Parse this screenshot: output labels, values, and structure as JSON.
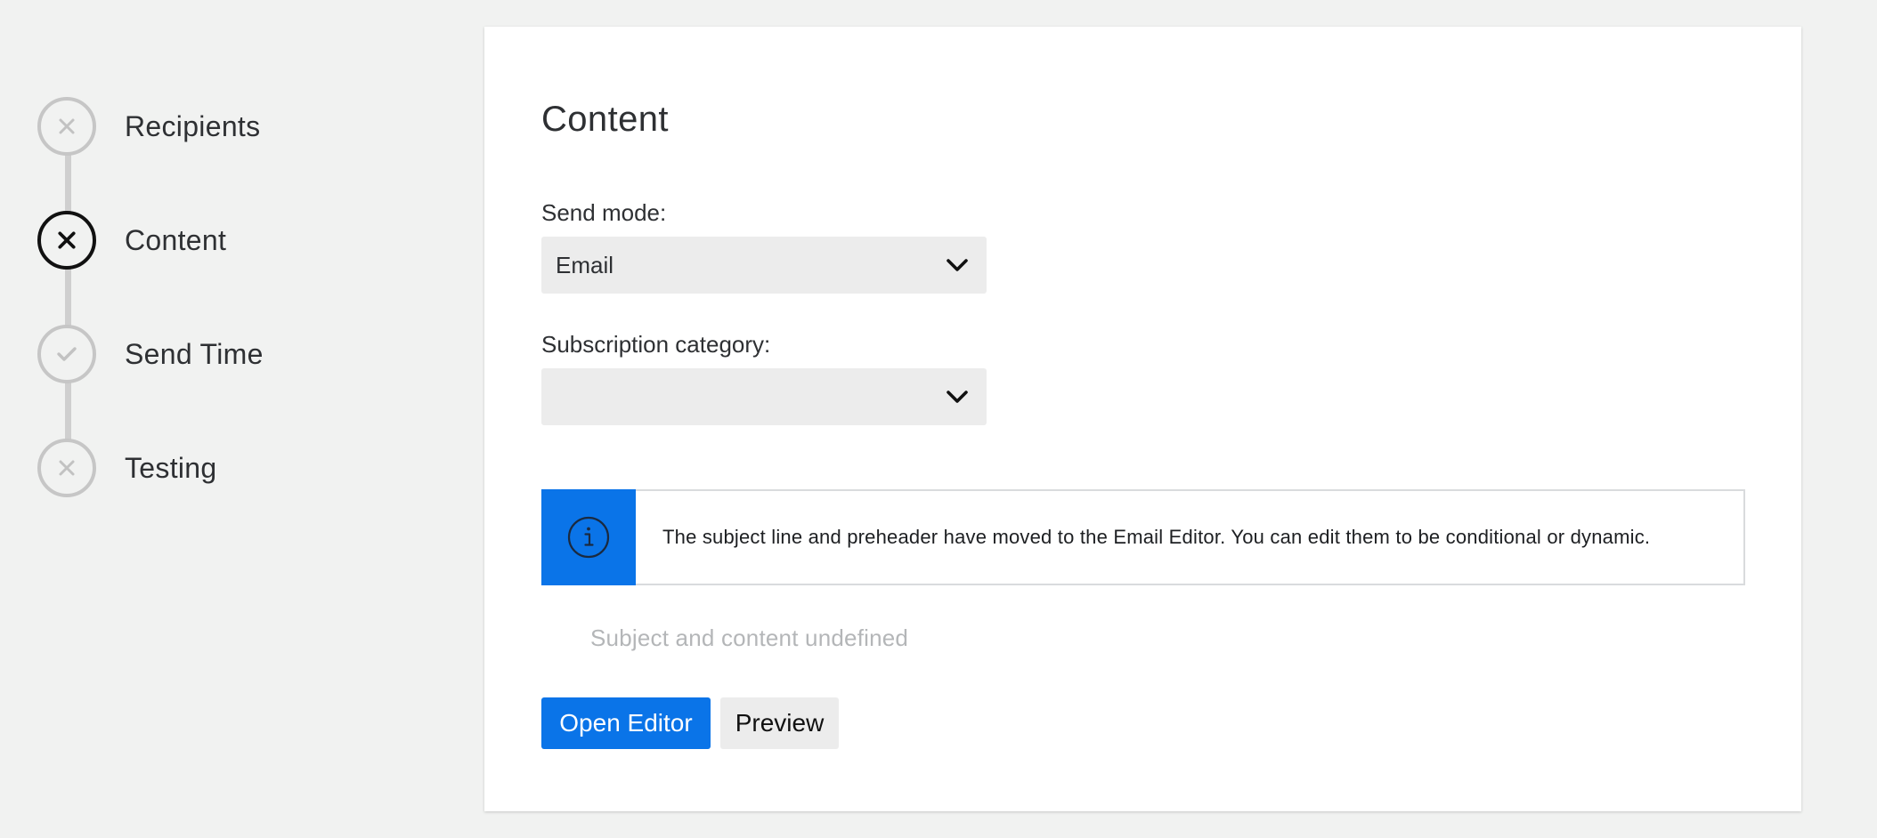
{
  "stepper": {
    "steps": [
      {
        "label": "Recipients",
        "status": "incomplete",
        "icon": "x-icon"
      },
      {
        "label": "Content",
        "status": "active",
        "icon": "x-icon"
      },
      {
        "label": "Send Time",
        "status": "complete",
        "icon": "check-icon"
      },
      {
        "label": "Testing",
        "status": "incomplete",
        "icon": "x-icon"
      }
    ]
  },
  "content": {
    "title": "Content",
    "send_mode": {
      "label": "Send mode:",
      "value": "Email"
    },
    "subscription_category": {
      "label": "Subscription category:",
      "value": ""
    },
    "notice": {
      "icon": "info-icon",
      "text": "The subject line and preheader have moved to the Email Editor. You can edit them to be conditional or dynamic."
    },
    "status_text": "Subject and content undefined",
    "buttons": {
      "open_editor": "Open Editor",
      "preview": "Preview"
    }
  },
  "colors": {
    "background": "#f1f2f1",
    "accent": "#0a74e8",
    "step_inactive": "#c6c6c6",
    "step_active": "#111111",
    "select_bg": "#ececec"
  }
}
